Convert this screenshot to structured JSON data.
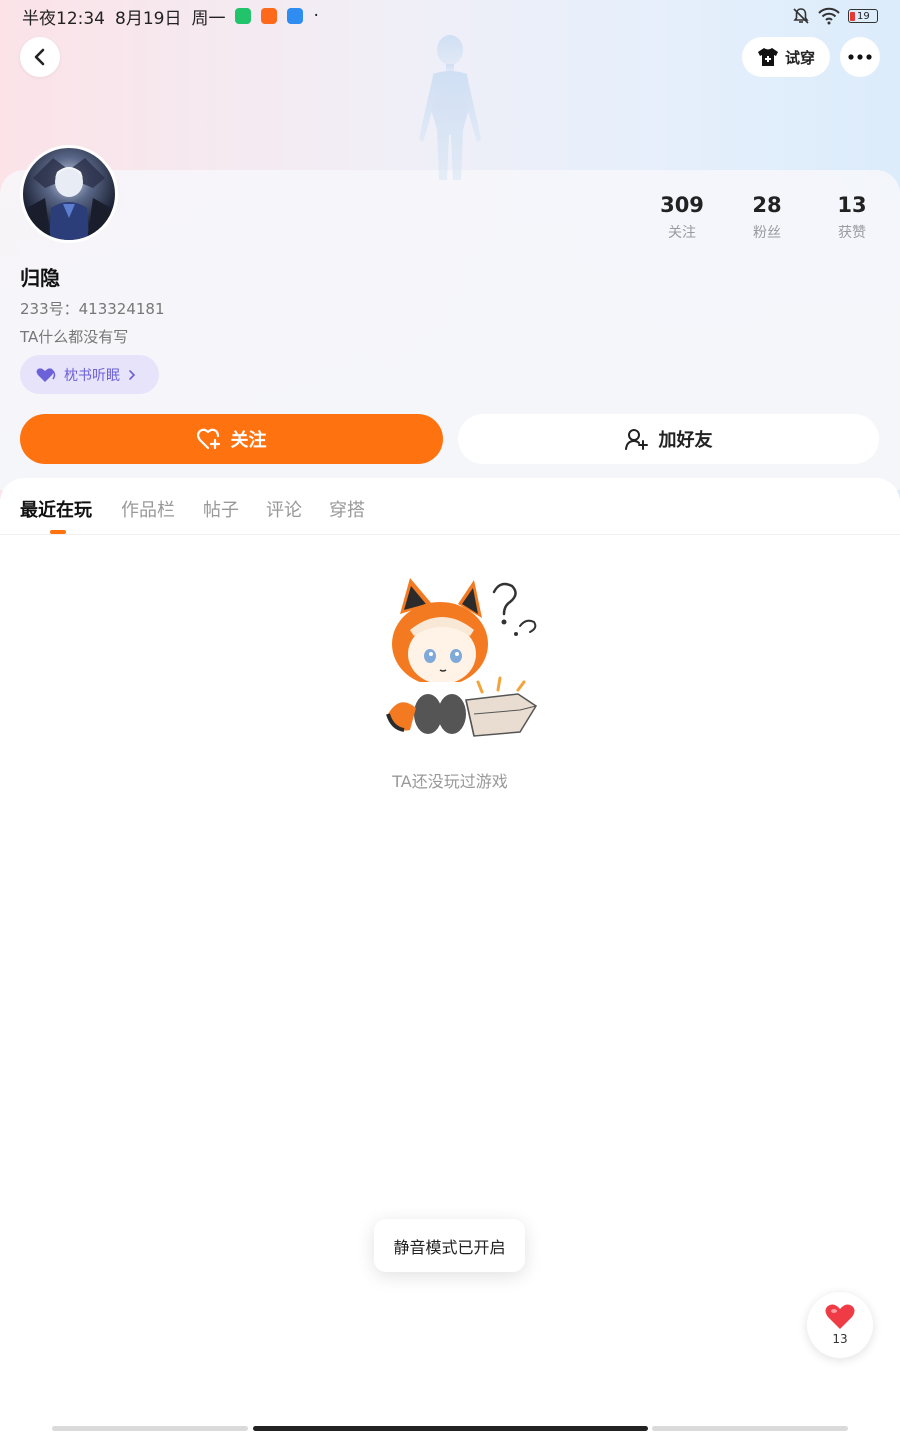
{
  "status_bar": {
    "time": "半夜12:34",
    "date": "8月19日",
    "weekday": "周一",
    "dot": "·",
    "battery": "19"
  },
  "header": {
    "try_on_label": "试穿"
  },
  "profile": {
    "nickname": "归隐",
    "uid": "233号：413324181",
    "bio": "TA什么都没有写",
    "badge_label": "枕书听眠",
    "stats": [
      {
        "value": "309",
        "label": "关注"
      },
      {
        "value": "28",
        "label": "粉丝"
      },
      {
        "value": "13",
        "label": "获赞"
      }
    ]
  },
  "actions": {
    "follow_label": "关注",
    "add_friend_label": "加好友"
  },
  "tabs": [
    {
      "label": "最近在玩",
      "active": true
    },
    {
      "label": "作品栏",
      "active": false
    },
    {
      "label": "帖子",
      "active": false
    },
    {
      "label": "评论",
      "active": false
    },
    {
      "label": "穿搭",
      "active": false
    }
  ],
  "empty_state": {
    "text": "TA还没玩过游戏"
  },
  "toast": {
    "text": "静音模式已开启"
  },
  "like_float": {
    "count": "13"
  },
  "colors": {
    "accent": "#ff7210",
    "badge_bg": "#e7e3fa",
    "badge_text": "#6d61d8"
  }
}
